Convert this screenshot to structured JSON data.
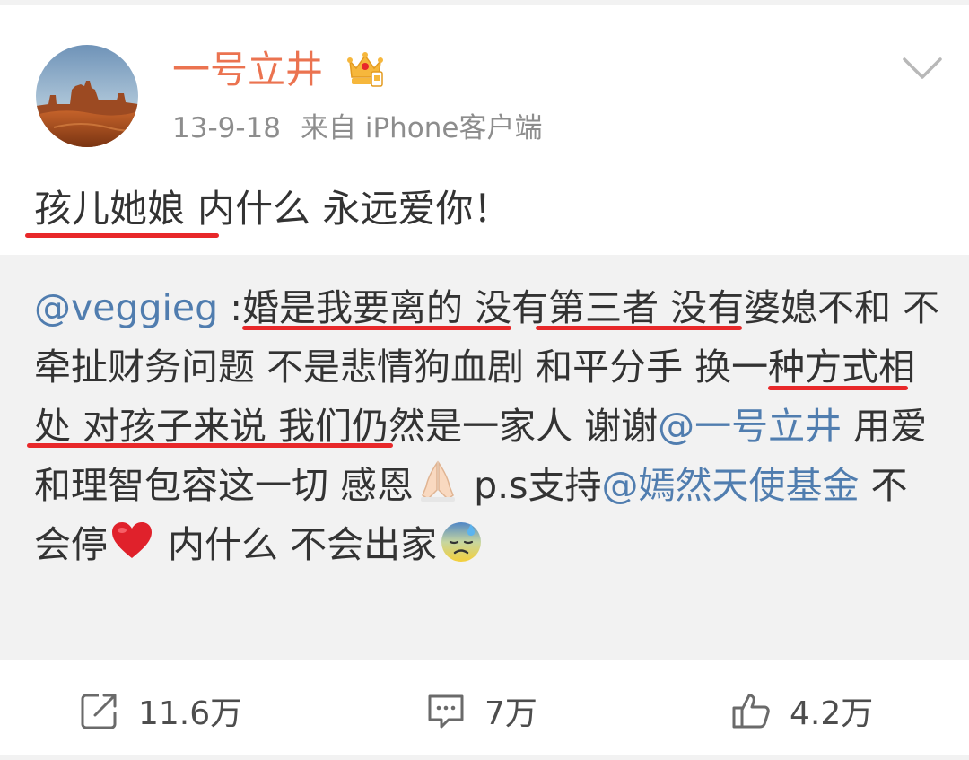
{
  "post": {
    "user": {
      "name": "一号立井",
      "avatar_icon": "desert-mesa-avatar",
      "badge_icon": "crown-vip-icon"
    },
    "date": "13-9-18",
    "source": "来自 iPhone客户端",
    "text": {
      "part1": "孩儿她娘",
      "part2": "内什么 永远爱你！"
    }
  },
  "repost": {
    "mention": "@veggieg",
    "colon": " :",
    "u1": "婚是我要离的",
    "t1": " ",
    "u2": "没有第三者",
    "t2": " 没有婆媳不和 不牵扯财务问题 不是悲情狗血剧 ",
    "u3": "和平分手 换一种方式相处",
    "t3": " 对孩子来说 我们仍然是一家人 谢谢",
    "mention2": "@一号立井",
    "t4": "  用爱和理智包容这一切 感恩",
    "t5": "  p.s支持",
    "mention3": "@嫣然天使基金",
    "t6": " 不会停",
    "t7": " 内什么 不会出家"
  },
  "actions": {
    "repost_count": "11.6万",
    "comment_count": "7万",
    "like_count": "4.2万"
  },
  "colors": {
    "username": "#eb7350",
    "link": "#507daf",
    "underline": "#e8282a",
    "repost_bg": "#f2f2f2"
  }
}
